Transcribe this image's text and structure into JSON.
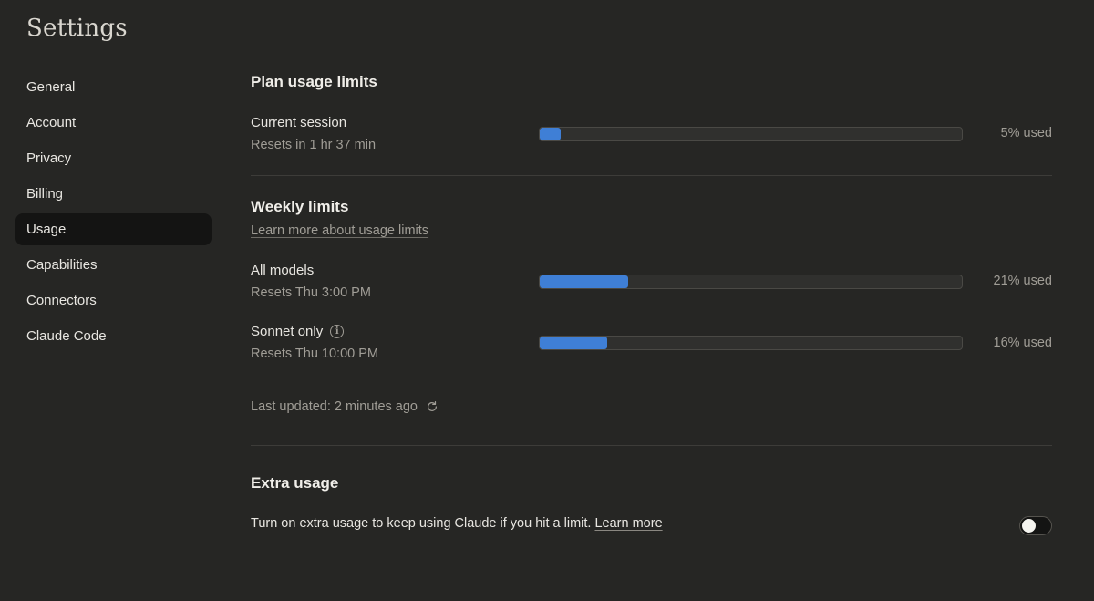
{
  "page": {
    "title": "Settings"
  },
  "sidebar": {
    "items": [
      {
        "label": "General"
      },
      {
        "label": "Account"
      },
      {
        "label": "Privacy"
      },
      {
        "label": "Billing"
      },
      {
        "label": "Usage",
        "active": true
      },
      {
        "label": "Capabilities"
      },
      {
        "label": "Connectors"
      },
      {
        "label": "Claude Code"
      }
    ]
  },
  "plan": {
    "title": "Plan usage limits",
    "session": {
      "label": "Current session",
      "reset": "Resets in 1 hr 37 min",
      "percent": 5,
      "used_text": "5% used"
    }
  },
  "weekly": {
    "title": "Weekly limits",
    "learn_more": "Learn more about usage limits",
    "all_models": {
      "label": "All models",
      "reset": "Resets Thu 3:00 PM",
      "percent": 21,
      "used_text": "21% used"
    },
    "sonnet": {
      "label": "Sonnet only",
      "info_icon": "i",
      "reset": "Resets Thu 10:00 PM",
      "percent": 16,
      "used_text": "16% used"
    },
    "last_updated": "Last updated: 2 minutes ago"
  },
  "extra": {
    "title": "Extra usage",
    "description": "Turn on extra usage to keep using Claude if you hit a limit.",
    "learn_more": "Learn more",
    "toggle_on": false
  },
  "colors": {
    "background": "#262624",
    "bar_fill": "#3f7fd6",
    "active_nav": "#141413"
  }
}
